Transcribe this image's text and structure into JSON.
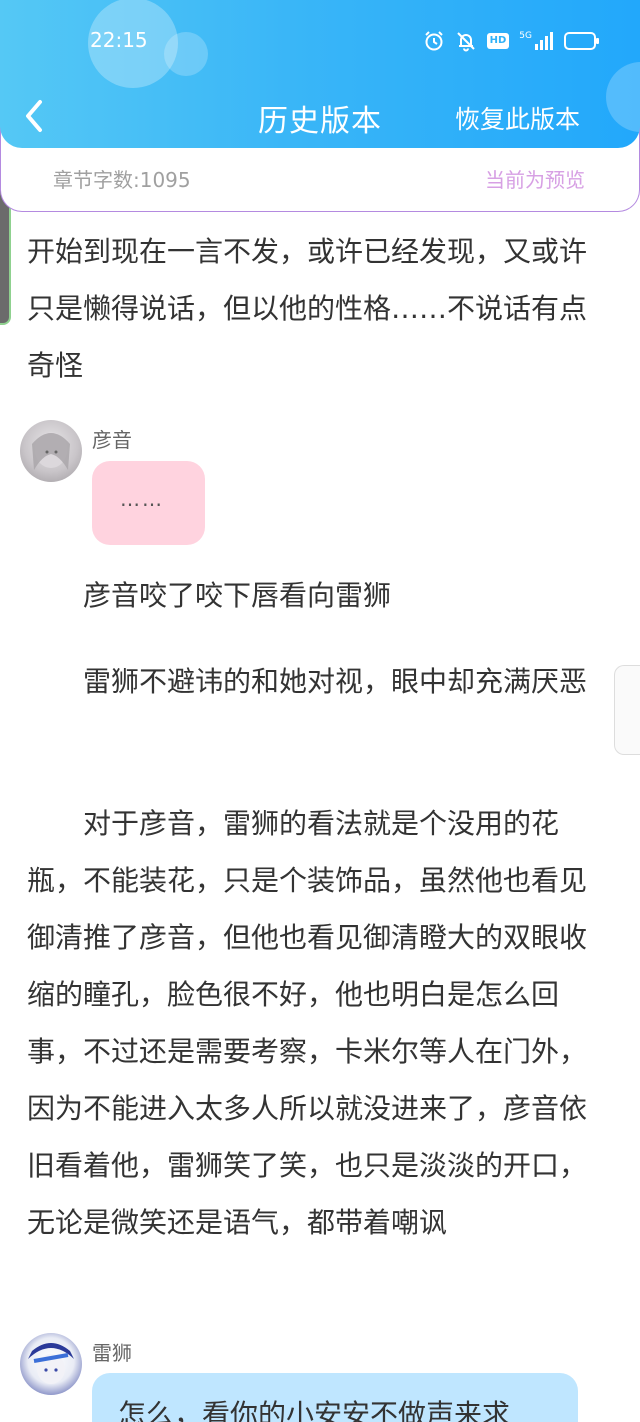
{
  "status_bar": {
    "time": "22:15",
    "icons": [
      "alarm-icon",
      "mute-icon",
      "hd-icon",
      "5g-signal-icon",
      "battery-icon"
    ],
    "hd_label": "HD",
    "network_label": "5G"
  },
  "header": {
    "back_icon": "chevron-left-icon",
    "title": "历史版本",
    "restore_label": "恢复此版本"
  },
  "info": {
    "word_count": "章节字数:1095",
    "preview_label": "当前为预览"
  },
  "content": {
    "para_top": "开始到现在一言不发，或许已经发现，又或许只是懒得说话，但以他的性格……不说话有点奇怪",
    "dialog1": {
      "speaker": "彦音",
      "text": "……"
    },
    "para1": "彦音咬了咬下唇看向雷狮",
    "para2": "雷狮不避讳的和她对视，眼中却充满厌恶",
    "para3": "对于彦音，雷狮的看法就是个没用的花瓶，不能装花，只是个装饰品，虽然他也看见御清推了彦音，但他也看见御清瞪大的双眼收缩的瞳孔，脸色很不好，他也明白是怎么回事，不过还是需要考察，卡米尔等人在门外，因为不能进入太多人所以就没进来了，彦音依旧看着他，雷狮笑了笑，也只是淡淡的开口，无论是微笑还是语气，都带着嘲讽",
    "dialog2": {
      "speaker": "雷狮",
      "text": "怎么，看你的小安安不做声来求"
    }
  },
  "colors": {
    "header_start": "#55c8f5",
    "header_end": "#22a8fb",
    "card_border": "#b48ae0",
    "preview_text": "#d7a0e4",
    "bubble_pink": "#ffd3df",
    "bubble_blue": "#bfe6ff"
  }
}
